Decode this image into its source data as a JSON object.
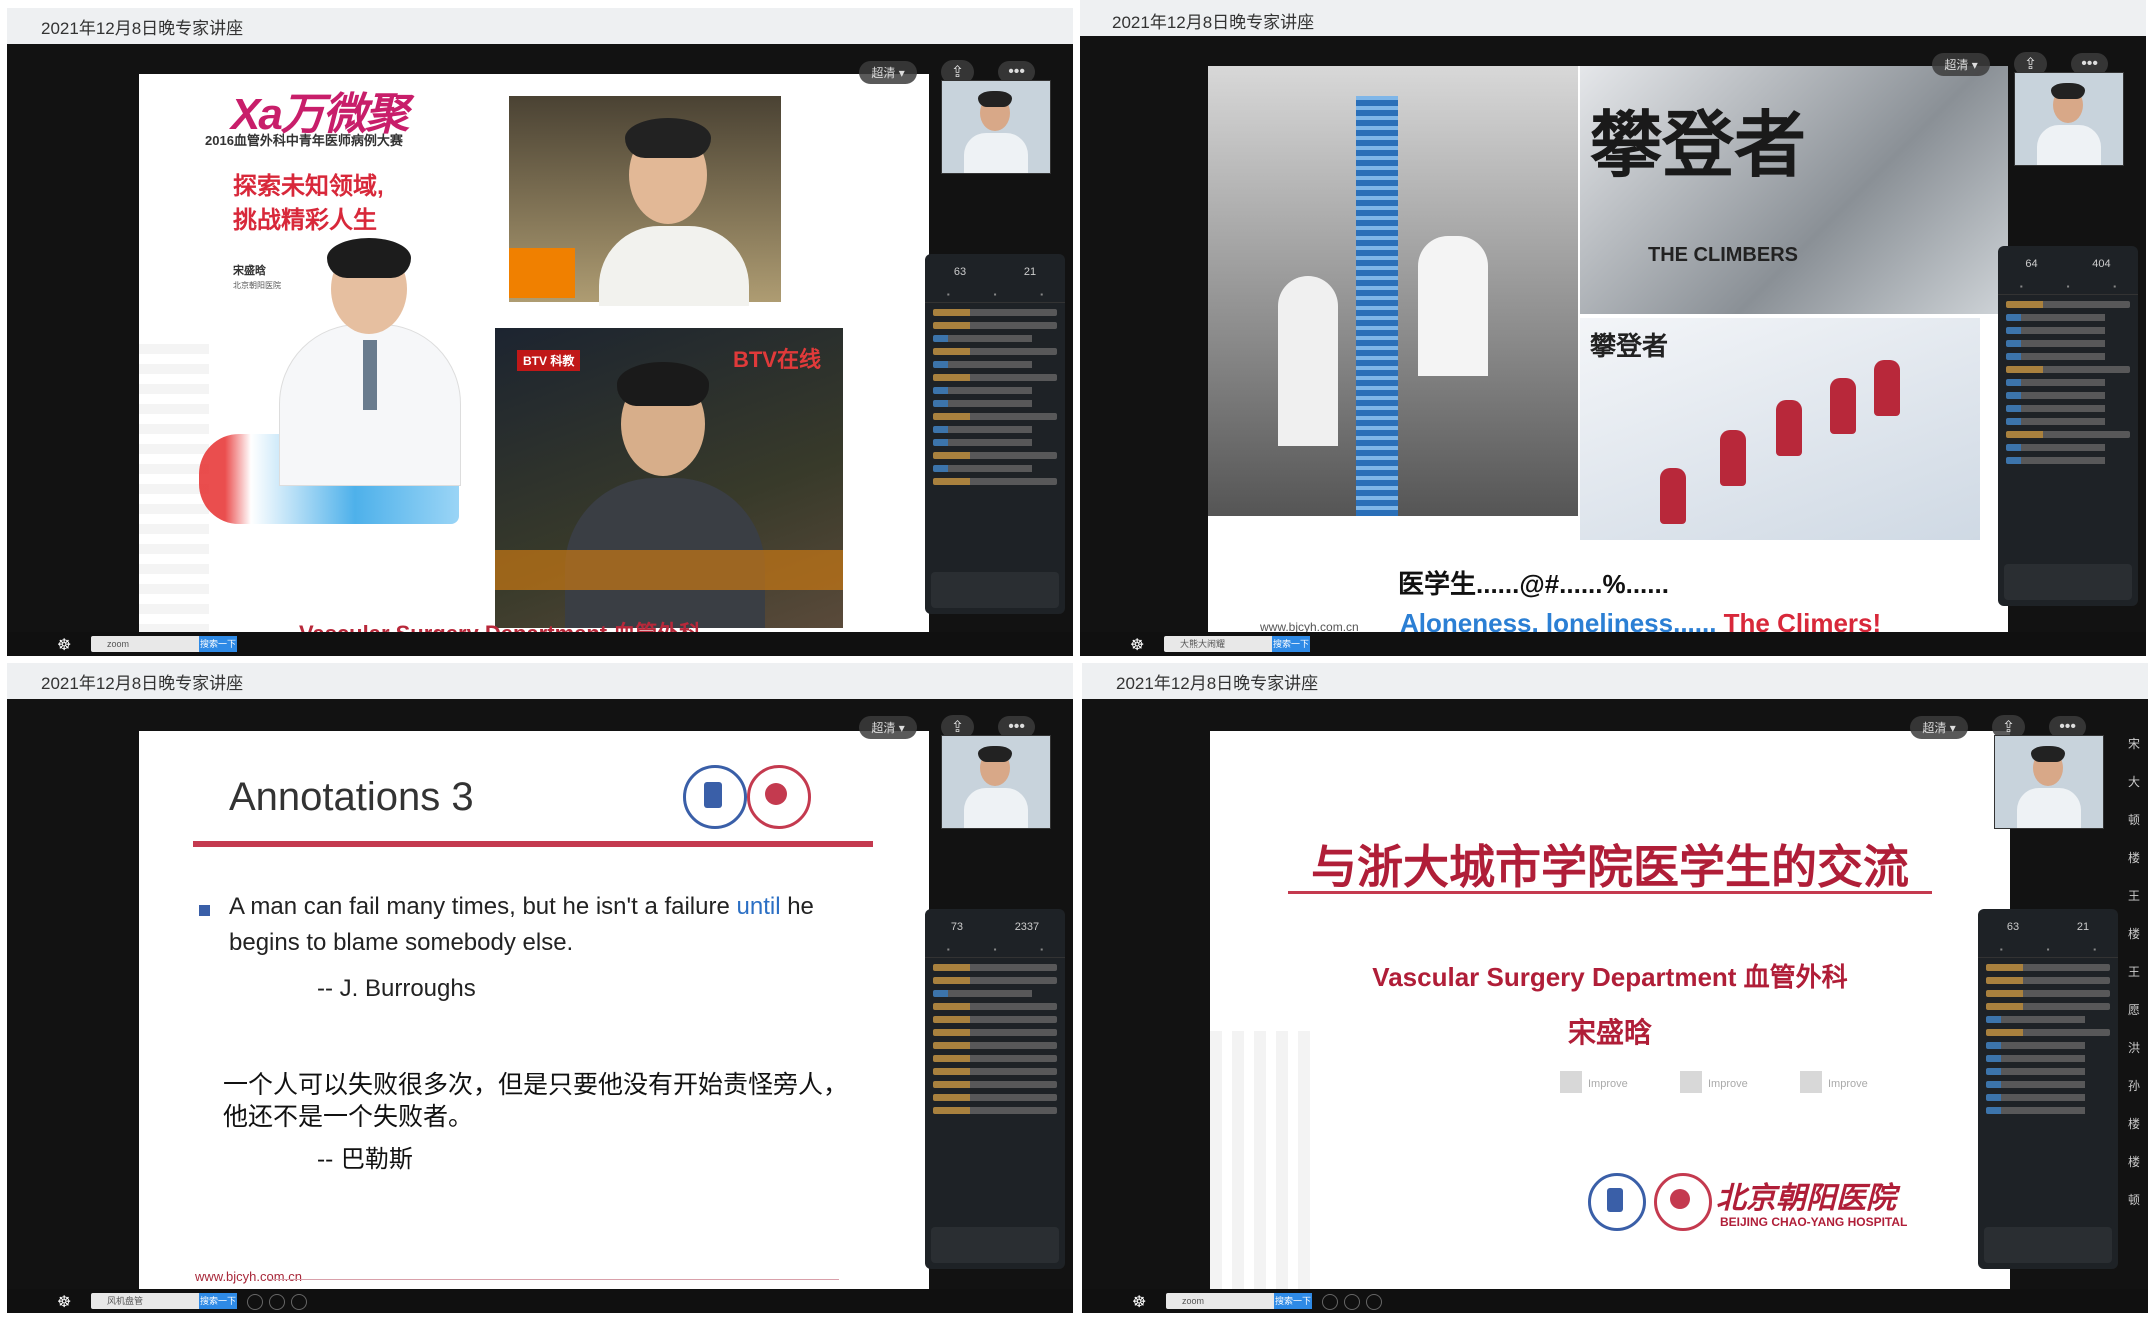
{
  "panels": {
    "p1": {
      "caption": "2021年12月8日晚专家讲座",
      "controls": {
        "quality": "超清 ▾",
        "share_icon": "⇪",
        "more_icon": "•••"
      },
      "chat": {
        "stats": [
          "63",
          "21"
        ]
      },
      "slide": {
        "logo": "Xa万微聚",
        "competition": "2016血管外科中青年医师病例大赛",
        "slogan_line1": "探索未知领域,",
        "slogan_line2": "挑战精彩人生",
        "name": "宋盛晗",
        "hospital": "北京朝阳医院",
        "btv_badge": "BTV 科教",
        "btv_badge2": "BTV在线",
        "footer": "Vascular Surgery Department 血管外科"
      },
      "taskbar": {
        "search_text": "zoom",
        "search_button": "搜索一下"
      }
    },
    "p2": {
      "caption": "2021年12月8日晚专家讲座",
      "controls": {
        "quality": "超清 ▾",
        "share_icon": "⇪",
        "more_icon": "•••"
      },
      "chat": {
        "stats": [
          "64",
          "404"
        ]
      },
      "slide": {
        "poster_title": "攀登者",
        "poster_en": "THE CLIMBERS",
        "snow_logo": "攀登者",
        "line1": "医学生......@#......%......",
        "line2_blue": "Aloneness, loneliness...... ",
        "line2_red": "The Climers!",
        "url": "www.bjcyh.com.cn"
      },
      "taskbar": {
        "search_text": "大熊大闹耀",
        "search_button": "搜索一下"
      }
    },
    "p3": {
      "caption": "2021年12月8日晚专家讲座",
      "controls": {
        "quality": "超清 ▾",
        "share_icon": "⇪",
        "more_icon": "•••"
      },
      "chat": {
        "stats": [
          "73",
          "2337"
        ]
      },
      "slide": {
        "title": "Annotations 3",
        "quote_en_a": "A man can fail many times, but he isn't a failure ",
        "quote_en_until": "until",
        "quote_en_b": " he begins to blame somebody else.",
        "author_en": "-- J. Burroughs",
        "quote_cn_1": "一个人可以失败很多次，但是只要他没有开始责怪旁人，",
        "quote_cn_2": "他还不是一个失败者。",
        "author_cn": "-- 巴勒斯",
        "url": "www.bjcyh.com.cn"
      },
      "taskbar": {
        "search_text": "风机盘管",
        "search_button": "搜索一下"
      }
    },
    "p4": {
      "caption": "2021年12月8日晚专家讲座",
      "controls": {
        "quality": "超清 ▾",
        "share_icon": "⇪",
        "more_icon": "•••"
      },
      "chat": {
        "stats": [
          "63",
          "21"
        ]
      },
      "slide": {
        "title": "与浙大城市学院医学生的交流",
        "dept": "Vascular Surgery Department 血管外科",
        "name": "宋盛晗",
        "improve": [
          "Improve",
          "Improve",
          "Improve"
        ],
        "hospital_cn": "北京朝阳医院",
        "hospital_en": "BEIJING CHAO-YANG HOSPITAL"
      },
      "side_strip": [
        "宋",
        "大",
        "顿",
        "楼",
        "王",
        "楼",
        "王",
        "愿",
        "洪",
        "孙",
        "楼",
        "楼",
        "顿"
      ],
      "taskbar": {
        "search_text": "zoom",
        "search_button": "搜索一下"
      }
    }
  }
}
